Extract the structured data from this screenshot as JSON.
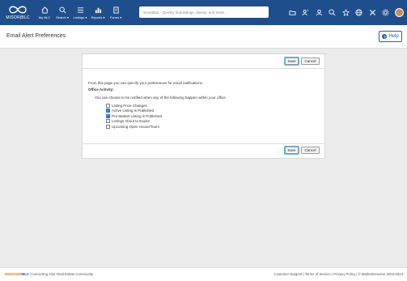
{
  "nav": {
    "logo_text": "MISOR|BLC",
    "items": [
      {
        "label": "My BLC",
        "icon": "home-icon"
      },
      {
        "label": "Search ▾",
        "icon": "search-icon"
      },
      {
        "label": "Listings ▾",
        "icon": "listings-icon"
      },
      {
        "label": "Reports ▾",
        "icon": "reports-icon"
      },
      {
        "label": "Forms ▾",
        "icon": "forms-icon"
      }
    ],
    "smartbar_placeholder": "SmartBar - Quickly find listings, clients, and more...",
    "right_icons": [
      "folder-icon",
      "contacts-icon",
      "user-icon",
      "search-icon",
      "star-icon",
      "globe-icon",
      "tools-icon",
      "settings-icon"
    ]
  },
  "header": {
    "title": "Email Alert Preferences",
    "help_label": "Help"
  },
  "form": {
    "save_label": "Save",
    "cancel_label": "Cancel",
    "intro": "From this page you can specify your preferences for email notifications.",
    "section_title": "Office Activity:",
    "description": "You can choose to be notified when any of the following happen within your office.",
    "options": [
      {
        "label": "Listing Price Changes",
        "checked": false
      },
      {
        "label": "Active Listing is Published",
        "checked": true
      },
      {
        "label": "Pre-Market Listing is Published",
        "checked": true
      },
      {
        "label": "Listings About to Expire",
        "checked": false
      },
      {
        "label": "Upcoming Open House/Tours",
        "checked": false
      }
    ]
  },
  "footer": {
    "brand_a": "MISSOURI",
    "brand_b": "BLC",
    "tagline": "Connecting Your Real Estate Community",
    "links": "Customer Support | Terms of Service | Privacy Policy | © MarketGenuine 2004-2024"
  },
  "colors": {
    "nav_bg": "#1f4e8c",
    "accent": "#2a5caa",
    "save_highlight": "#5ab7e6"
  }
}
